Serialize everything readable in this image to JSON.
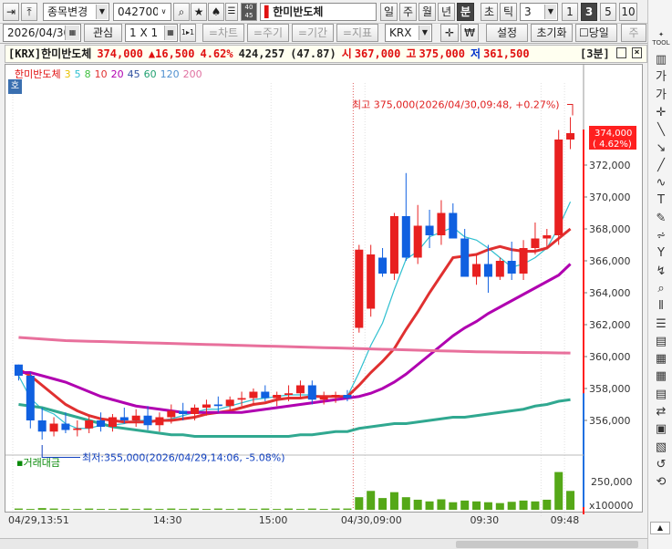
{
  "toolbar": {
    "prev_icon": "⇥",
    "pin_icon": "⤒",
    "mode_label": "종목변경",
    "code_value": "042700",
    "search_icon": "⌕",
    "star_icon": "★",
    "up_icon": "♠",
    "list_icon": "☰",
    "badge": "40\n45",
    "stock_name": "한미반도체",
    "periods": [
      "일",
      "주",
      "월",
      "년",
      "분",
      "초",
      "틱"
    ],
    "period_selected": "분",
    "interval_value": "3",
    "steps": [
      "1",
      "3",
      "5",
      "10"
    ],
    "step_selected": "3",
    "u_label": "U"
  },
  "toolbar2": {
    "date_value": "2026/04/30",
    "watch_label": "관심",
    "layout_label": "1 X 1",
    "one_label": "1▸1",
    "chart_label": "=차트",
    "cycle_label": "=주기",
    "range_label": "=기간",
    "ind_label": "=지표",
    "market_value": "KRX",
    "krw_label": "₩",
    "settings_label": "설정",
    "reset_label": "초기화",
    "today_label": "당일",
    "more_label": "주"
  },
  "info": {
    "market": "[KRX]한미반도체",
    "price": "374,000",
    "change": "▲16,500",
    "pct": "4.62%",
    "volume": "424,257",
    "vol_ratio": "(47.87)",
    "open_label": "시",
    "open": "367,000",
    "high_label": "고",
    "high": "375,000",
    "low_label": "저",
    "low": "361,500",
    "period_tag": "[3분]"
  },
  "legend": {
    "name": "한미반도체",
    "mas": [
      "3",
      "5",
      "8",
      "10",
      "20",
      "45",
      "60",
      "120",
      "200"
    ],
    "colors": [
      "#e8c000",
      "#30c0d0",
      "#40c040",
      "#e03030",
      "#b000b0",
      "#3050a0",
      "#20a070",
      "#5090d0",
      "#e070a0"
    ]
  },
  "annot": {
    "hi": "최고 375,000(2026/04/30,09:48, +0.27%)",
    "lo": "최저:355,000(2026/04/29,14:06, -5.08%)",
    "cur_price": "374,000",
    "cur_pct": "( 4.62%)"
  },
  "vol_label": "거래대금",
  "vol_ticks": [
    "250,000",
    "x100000"
  ],
  "x_ticks": [
    "04/29,13:51",
    "14:30",
    "15:00",
    "04/30,09:00",
    "09:30",
    "09:48"
  ],
  "chart_data": {
    "type": "candlestick",
    "ylim": [
      354000,
      376000
    ],
    "y_ticks": [
      356000,
      358000,
      360000,
      362000,
      364000,
      366000,
      368000,
      370000,
      372000
    ],
    "candles": [
      [
        359500,
        359500,
        358500,
        358800
      ],
      [
        358800,
        359000,
        355500,
        356000
      ],
      [
        356000,
        356800,
        354800,
        355300
      ],
      [
        355300,
        356200,
        355000,
        355800
      ],
      [
        355800,
        356500,
        355200,
        355400
      ],
      [
        355400,
        356000,
        355000,
        355500
      ],
      [
        355500,
        356300,
        355200,
        356000
      ],
      [
        356000,
        356500,
        355300,
        355600
      ],
      [
        355600,
        356400,
        355300,
        356200
      ],
      [
        356200,
        356800,
        355800,
        356000
      ],
      [
        356000,
        356700,
        355600,
        356300
      ],
      [
        356300,
        356900,
        355400,
        355700
      ],
      [
        355700,
        356500,
        355300,
        356200
      ],
      [
        356200,
        357000,
        355800,
        356600
      ],
      [
        356600,
        357100,
        356000,
        356400
      ],
      [
        356400,
        357000,
        356000,
        356800
      ],
      [
        356800,
        357300,
        356300,
        357000
      ],
      [
        357000,
        357500,
        356500,
        356900
      ],
      [
        356900,
        357500,
        356600,
        357300
      ],
      [
        357300,
        357800,
        356900,
        357400
      ],
      [
        357400,
        358000,
        357000,
        357800
      ],
      [
        357800,
        358200,
        357200,
        357400
      ],
      [
        357400,
        357800,
        356900,
        357600
      ],
      [
        357600,
        358200,
        357200,
        357700
      ],
      [
        357700,
        358500,
        357400,
        358200
      ],
      [
        358200,
        358500,
        357000,
        357300
      ],
      [
        357300,
        357800,
        357000,
        357500
      ],
      [
        357500,
        357800,
        357100,
        357600
      ],
      [
        357600,
        357900,
        357200,
        357400
      ],
      [
        361800,
        367000,
        361500,
        366700
      ],
      [
        363000,
        367000,
        362500,
        366400
      ],
      [
        366200,
        366800,
        365000,
        365200
      ],
      [
        365200,
        369000,
        364800,
        368800
      ],
      [
        368800,
        371500,
        366000,
        366200
      ],
      [
        366200,
        369500,
        365800,
        368200
      ],
      [
        368200,
        369200,
        366800,
        367600
      ],
      [
        367600,
        369800,
        367000,
        369000
      ],
      [
        369000,
        369600,
        367600,
        367400
      ],
      [
        367400,
        368000,
        365000,
        365000
      ],
      [
        365000,
        366400,
        364500,
        365800
      ],
      [
        365800,
        367000,
        364000,
        365000
      ],
      [
        365000,
        366200,
        364800,
        366000
      ],
      [
        366000,
        367200,
        364800,
        365200
      ],
      [
        365200,
        367300,
        364800,
        366800
      ],
      [
        366800,
        368400,
        366400,
        367400
      ],
      [
        367400,
        368000,
        366800,
        367600
      ],
      [
        367600,
        374200,
        367000,
        373600
      ],
      [
        373600,
        375000,
        373000,
        374000
      ]
    ],
    "ma": [
      {
        "name": "5",
        "color": "#30c0d0",
        "values": [
          358800,
          357400,
          356700,
          356400,
          355800,
          355500,
          355500,
          355700,
          355700,
          355800,
          356000,
          356000,
          356000,
          356100,
          356300,
          356500,
          356700,
          356700,
          356900,
          357100,
          357300,
          357400,
          357500,
          357600,
          357600,
          357600,
          357500,
          357500,
          357500,
          359000,
          360700,
          362100,
          364200,
          366100,
          366600,
          367500,
          367800,
          368100,
          367500,
          367300,
          366800,
          366200,
          365600,
          365800,
          366200,
          366800,
          368100,
          369700
        ]
      },
      {
        "name": "10",
        "color": "#e03030",
        "values": [
          359200,
          358800,
          358200,
          357600,
          357000,
          356600,
          356300,
          356100,
          356000,
          355900,
          355900,
          355900,
          356000,
          356000,
          356100,
          356200,
          356400,
          356500,
          356600,
          356800,
          357000,
          357100,
          357300,
          357400,
          357400,
          357500,
          357500,
          357500,
          357500,
          358200,
          359000,
          359700,
          360500,
          361700,
          362800,
          364000,
          365100,
          366200,
          366300,
          366400,
          366700,
          366900,
          366700,
          366600,
          366600,
          366800,
          367400,
          368000
        ]
      },
      {
        "name": "20",
        "color": "#b000b0",
        "values": [
          359000,
          359000,
          358800,
          358600,
          358400,
          358100,
          357800,
          357500,
          357300,
          357100,
          356900,
          356800,
          356700,
          356600,
          356500,
          356500,
          356500,
          356500,
          356500,
          356500,
          356600,
          356700,
          356800,
          356900,
          357000,
          357100,
          357200,
          357300,
          357400,
          357500,
          357700,
          358000,
          358400,
          358900,
          359500,
          360100,
          360700,
          361300,
          361800,
          362200,
          362700,
          363100,
          363500,
          363900,
          364300,
          364700,
          365100,
          365800
        ]
      },
      {
        "name": "60",
        "color": "#30a890",
        "values": [
          357000,
          356900,
          356800,
          356600,
          356400,
          356200,
          356000,
          355800,
          355600,
          355500,
          355400,
          355300,
          355200,
          355100,
          355100,
          355000,
          355000,
          355000,
          355000,
          355000,
          355000,
          355000,
          355000,
          355000,
          355100,
          355100,
          355200,
          355300,
          355300,
          355500,
          355600,
          355700,
          355800,
          355800,
          355900,
          356000,
          356100,
          356200,
          356200,
          356300,
          356400,
          356500,
          356600,
          356700,
          356900,
          357000,
          357200,
          357300
        ]
      },
      {
        "name": "200",
        "color": "#e8709c",
        "values": [
          361200,
          361150,
          361100,
          361050,
          361000,
          360980,
          360960,
          360940,
          360920,
          360900,
          360880,
          360860,
          360840,
          360820,
          360800,
          360780,
          360760,
          360740,
          360720,
          360700,
          360680,
          360660,
          360640,
          360620,
          360600,
          360580,
          360560,
          360540,
          360520,
          360500,
          360480,
          360460,
          360440,
          360420,
          360400,
          360380,
          360360,
          360340,
          360320,
          360300,
          360290,
          360280,
          360270,
          360260,
          360250,
          360240,
          360230,
          360220
        ]
      }
    ],
    "volumes": [
      3,
      2,
      4,
      3,
      2,
      2,
      3,
      2,
      2,
      3,
      2,
      3,
      2,
      3,
      2,
      3,
      2,
      3,
      2,
      3,
      2,
      3,
      2,
      3,
      2,
      3,
      2,
      3,
      3,
      30,
      45,
      28,
      42,
      30,
      24,
      20,
      25,
      18,
      22,
      20,
      18,
      16,
      19,
      22,
      20,
      24,
      90,
      45
    ]
  }
}
